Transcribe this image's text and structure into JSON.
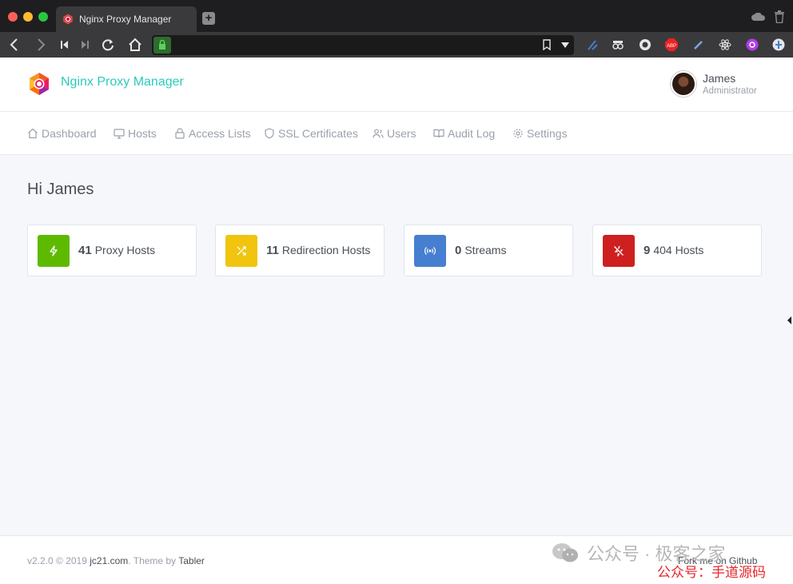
{
  "browser": {
    "tab_title": "Nginx Proxy Manager",
    "new_tab_label": "+"
  },
  "app": {
    "brand": "Nginx Proxy Manager",
    "user": {
      "name": "James",
      "role": "Administrator"
    }
  },
  "nav": [
    {
      "id": "dashboard",
      "label": "Dashboard",
      "icon": "home-icon"
    },
    {
      "id": "hosts",
      "label": "Hosts",
      "icon": "monitor-icon"
    },
    {
      "id": "access-lists",
      "label": "Access Lists",
      "icon": "lock-icon"
    },
    {
      "id": "ssl",
      "label": "SSL Certificates",
      "icon": "shield-icon"
    },
    {
      "id": "users",
      "label": "Users",
      "icon": "users-icon"
    },
    {
      "id": "audit-log",
      "label": "Audit Log",
      "icon": "book-open-icon"
    },
    {
      "id": "settings",
      "label": "Settings",
      "icon": "gear-icon"
    }
  ],
  "greeting": "Hi James",
  "cards": [
    {
      "count": "41",
      "label": "Proxy Hosts",
      "color": "#5eba00",
      "icon": "zap-icon"
    },
    {
      "count": "11",
      "label": "Redirection Hosts",
      "color": "#f1c40f",
      "icon": "shuffle-icon"
    },
    {
      "count": "0",
      "label": "Streams",
      "color": "#467fcf",
      "icon": "radio-icon"
    },
    {
      "count": "9",
      "label": "404 Hosts",
      "color": "#cd201f",
      "icon": "zap-off-icon"
    }
  ],
  "footer": {
    "version": "v2.2.0 © 2019",
    "company": "jc21.com",
    "theme_prefix": ". Theme by",
    "theme": "Tabler",
    "github": "Fork me on Github"
  },
  "watermark": {
    "line1": "公众号 · 极客之家",
    "line2": "公众号：手道源码"
  },
  "colors": {
    "brand": "#2bcbba",
    "nav_text": "#9aa0ac",
    "body_text": "#495057"
  }
}
